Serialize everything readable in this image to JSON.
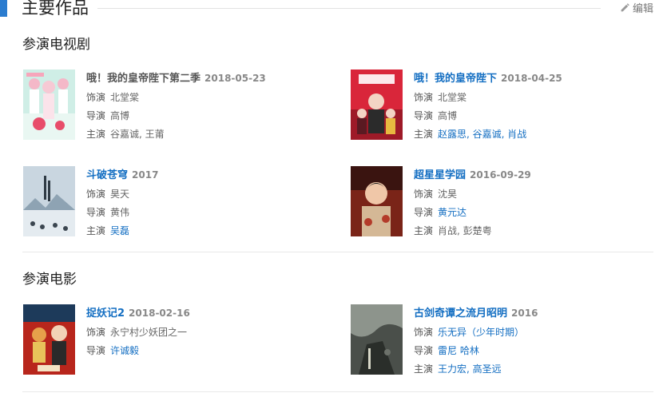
{
  "header": {
    "title": "主要作品",
    "edit_label": "编辑"
  },
  "tv": {
    "heading": "参演电视剧",
    "items": [
      {
        "title": "哦！我的皇帝陛下第二季",
        "date": "2018-05-23",
        "role_label": "饰演",
        "role": "北堂棠",
        "director_label": "导演",
        "director": "高博",
        "cast_label": "主演",
        "cast": "谷嘉诚, 王莆"
      },
      {
        "title": "哦！我的皇帝陛下",
        "date": "2018-04-25",
        "role_label": "饰演",
        "role": "北堂棠",
        "director_label": "导演",
        "director": "高博",
        "cast_label": "主演",
        "cast": "赵露思, 谷嘉诚, 肖战"
      },
      {
        "title": "斗破苍穹",
        "date": "2017",
        "role_label": "饰演",
        "role": "昊天",
        "director_label": "导演",
        "director": "黄伟",
        "cast_label": "主演",
        "cast": "吴磊"
      },
      {
        "title": "超星星学园",
        "date": "2016-09-29",
        "role_label": "饰演",
        "role": "沈昊",
        "director_label": "导演",
        "director": "黄元达",
        "cast_label": "主演",
        "cast": "肖战, 彭楚粤"
      }
    ]
  },
  "movie": {
    "heading": "参演电影",
    "items": [
      {
        "title": "捉妖记2",
        "date": "2018-02-16",
        "role_label": "饰演",
        "role": "永宁村少妖团之一",
        "director_label": "导演",
        "director": "许诚毅"
      },
      {
        "title": "古剑奇谭之流月昭明",
        "date": "2016",
        "role_label": "饰演",
        "role": "乐无异（少年时期）",
        "director_label": "导演",
        "director": "雷尼 哈林",
        "cast_label": "主演",
        "cast": "王力宏, 高圣远"
      }
    ]
  },
  "colors": {
    "accent": "#2b7ccf",
    "link": "#136ec2",
    "text": "#555555"
  },
  "icons": {
    "edit": "pencil-icon"
  }
}
